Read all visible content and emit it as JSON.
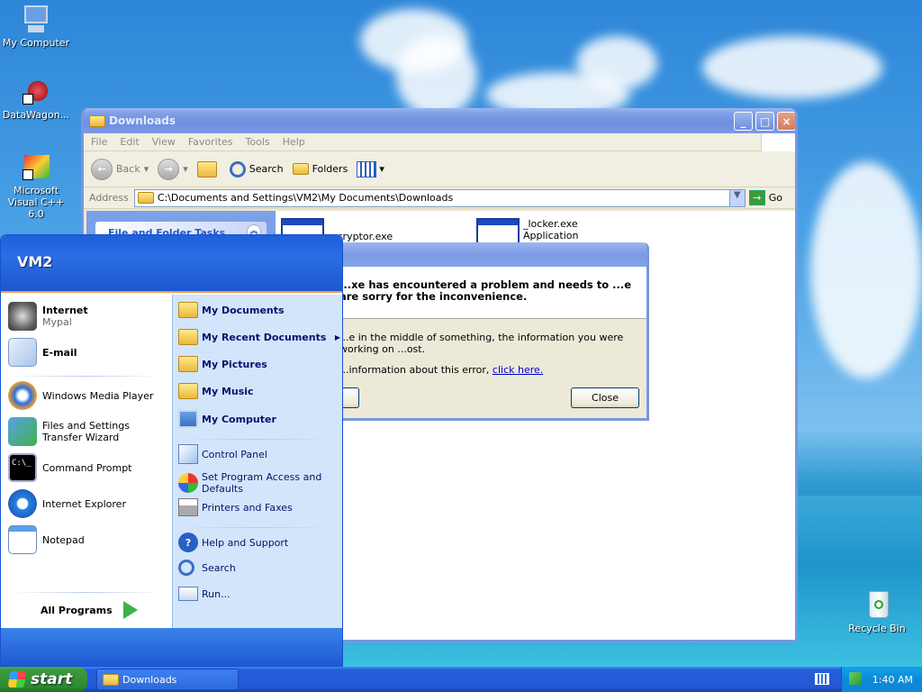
{
  "desktop": {
    "icons": [
      {
        "label": "My Computer"
      },
      {
        "label": "DataWagon..."
      },
      {
        "label": "Microsoft Visual C++ 6.0"
      },
      {
        "label": "Recycle Bin"
      }
    ]
  },
  "explorer": {
    "title": "Downloads",
    "menu": [
      "File",
      "Edit",
      "View",
      "Favorites",
      "Tools",
      "Help"
    ],
    "toolbar": {
      "back": "Back",
      "search": "Search",
      "folders": "Folders"
    },
    "address_label": "Address",
    "address_value": "C:\\Documents and Settings\\VM2\\My Documents\\Downloads",
    "go_label": "Go",
    "tasks_header": "File and Folder Tasks",
    "files": [
      {
        "name": "...cryptor.exe"
      },
      {
        "name": "_locker.exe",
        "type": "Application"
      }
    ]
  },
  "error_dialog": {
    "heading": "...xe has encountered a problem and needs to ...e are sorry for the inconvenience.",
    "line1": "...e in the middle of something, the information you were working on ...ost.",
    "line2_prefix": "...information about this error,",
    "link": "click here.",
    "close_label": "Close"
  },
  "start_menu": {
    "user": "VM2",
    "pinned": [
      {
        "label": "Internet",
        "sub": "Mypal"
      },
      {
        "label": "E-mail"
      }
    ],
    "recent": [
      {
        "label": "Windows Media Player"
      },
      {
        "label": "Files and Settings Transfer Wizard"
      },
      {
        "label": "Command Prompt"
      },
      {
        "label": "Internet Explorer"
      },
      {
        "label": "Notepad"
      }
    ],
    "all_programs": "All Programs",
    "right": [
      {
        "label": "My Documents"
      },
      {
        "label": "My Recent Documents"
      },
      {
        "label": "My Pictures"
      },
      {
        "label": "My Music"
      },
      {
        "label": "My Computer"
      },
      {
        "label": "Control Panel"
      },
      {
        "label": "Set Program Access and Defaults"
      },
      {
        "label": "Printers and Faxes"
      },
      {
        "label": "Help and Support"
      },
      {
        "label": "Search"
      },
      {
        "label": "Run..."
      }
    ]
  },
  "taskbar": {
    "start_label": "start",
    "task": "Downloads",
    "clock": "1:40 AM"
  }
}
